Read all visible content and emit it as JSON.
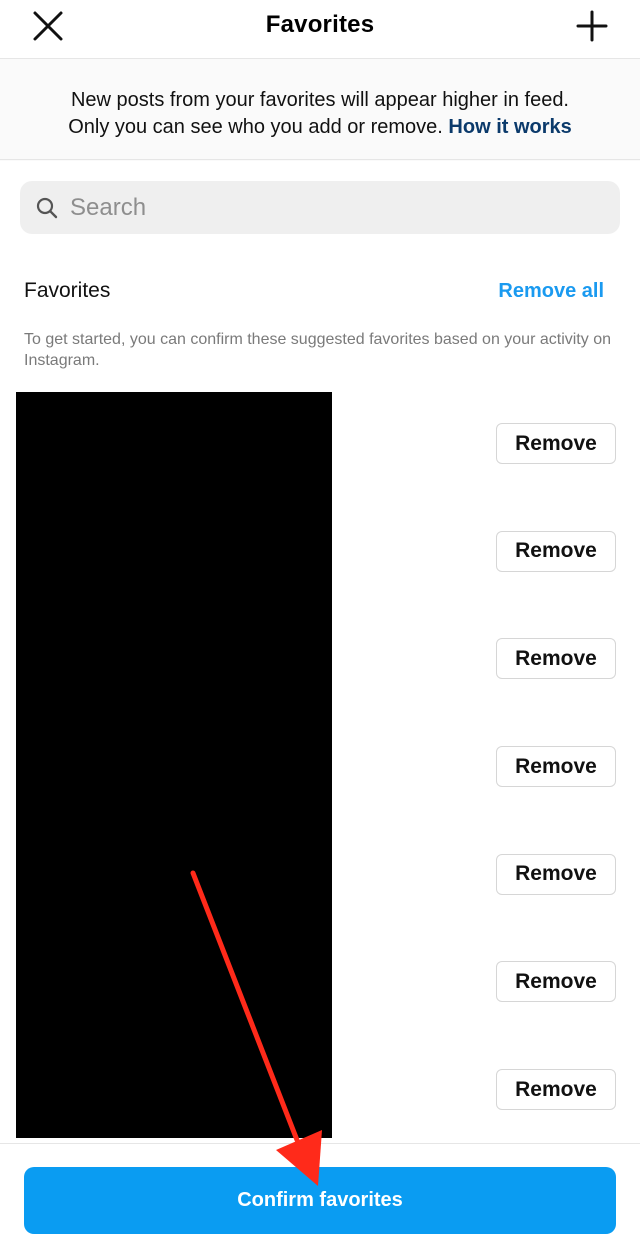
{
  "header": {
    "title": "Favorites",
    "close_icon": "close-icon",
    "add_icon": "plus-icon"
  },
  "info": {
    "line1": "New posts from your favorites will appear higher in feed.",
    "line2": "Only you can see who you add or remove.",
    "link": "How it works"
  },
  "search": {
    "placeholder": "Search",
    "icon": "search-icon"
  },
  "favorites": {
    "heading": "Favorites",
    "remove_all": "Remove all",
    "hint": "To get started, you can confirm these suggested favorites based on your activity on Instagram.",
    "items": [
      {
        "action": "Remove"
      },
      {
        "action": "Remove"
      },
      {
        "action": "Remove"
      },
      {
        "action": "Remove"
      },
      {
        "action": "Remove"
      },
      {
        "action": "Remove"
      },
      {
        "action": "Remove"
      }
    ]
  },
  "footer": {
    "confirm_label": "Confirm favorites"
  },
  "colors": {
    "accent": "#0a9cf2",
    "link_dark": "#0b3a6b",
    "annotation_arrow": "#ff2a1a"
  }
}
